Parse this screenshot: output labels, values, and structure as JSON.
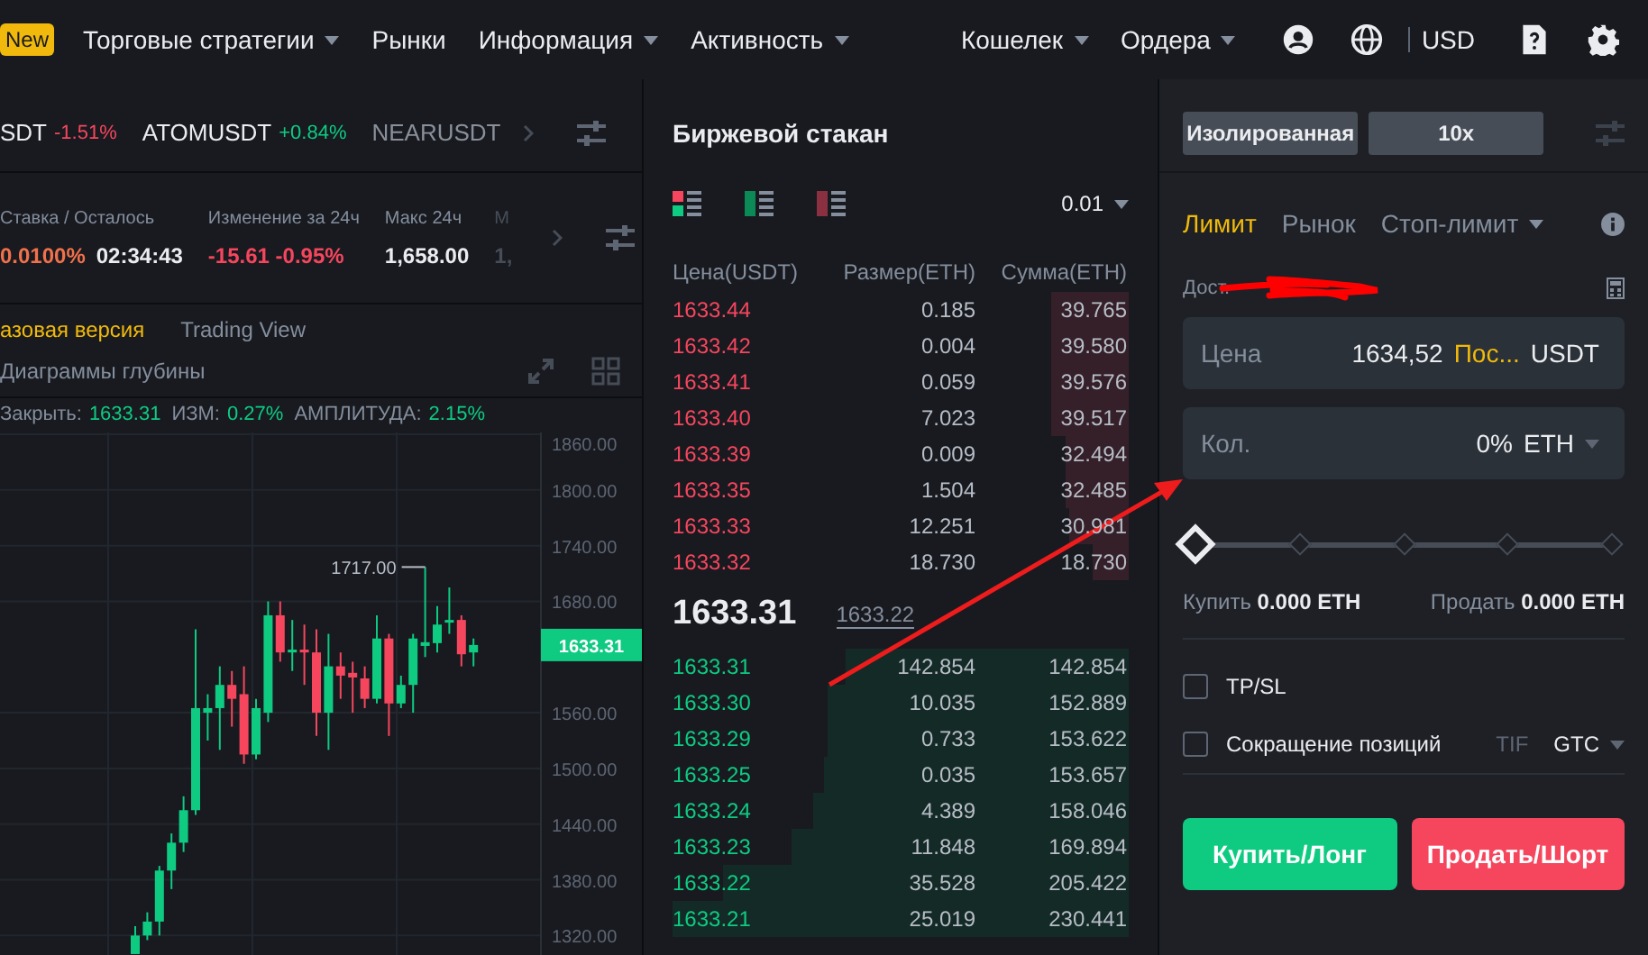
{
  "top_nav": {
    "badge": "New",
    "left_items": [
      {
        "label": "Торговые стратегии",
        "dropdown": true
      },
      {
        "label": "Рынки",
        "dropdown": false
      },
      {
        "label": "Информация",
        "dropdown": true
      },
      {
        "label": "Активность",
        "dropdown": true
      }
    ],
    "right_items": [
      {
        "label": "Кошелек",
        "dropdown": true
      },
      {
        "label": "Ордера",
        "dropdown": true
      }
    ],
    "currency": "USD"
  },
  "ticker": [
    {
      "symbol": "SDT",
      "change": "-1.51%",
      "color": "#f6465d",
      "faded": false
    },
    {
      "symbol": "ATOMUSDT",
      "change": "+0.84%",
      "color": "#0ecb81",
      "faded": false
    },
    {
      "symbol": "NEARUSDT",
      "faded": true
    }
  ],
  "stats": [
    {
      "label": "Ставка / Осталось",
      "faded": false,
      "values": [
        {
          "text": "0.0100%",
          "color": "#f0714b"
        },
        {
          "text": "02:34:43",
          "color": "#eaecef"
        }
      ]
    },
    {
      "label": "Изменение за 24ч",
      "faded": false,
      "values": [
        {
          "text": "-15.61 -0.95%",
          "color": "#f6465d"
        }
      ]
    },
    {
      "label": "Макс 24ч",
      "faded": false,
      "values": [
        {
          "text": "1,658.00",
          "color": "#eaecef"
        }
      ]
    },
    {
      "label": "М",
      "faded": true,
      "values": [
        {
          "text": "1,",
          "color": "#474d57"
        }
      ]
    }
  ],
  "chart_tabs": [
    {
      "label": "азовая версия",
      "selected": true
    },
    {
      "label": "Trading View",
      "selected": false
    }
  ],
  "depth_link": "Диаграммы глубины",
  "ohlc": [
    {
      "label": "Закрыть:",
      "value": "1633.31"
    },
    {
      "label": "ИЗМ:",
      "value": "0.27%"
    },
    {
      "label": "АМПЛИТУДА:",
      "value": "2.15%"
    }
  ],
  "chart": {
    "high_label": "1717.00",
    "last_price": "1633.31",
    "chart_data": {
      "type": "candlestick",
      "grid": true,
      "ylim": [
        1299,
        1862
      ],
      "ohlc": [
        [
          1300,
          1330,
          1300,
          1320
        ],
        [
          1320,
          1345,
          1315,
          1335
        ],
        [
          1335,
          1395,
          1320,
          1390
        ],
        [
          1390,
          1430,
          1370,
          1420
        ],
        [
          1420,
          1470,
          1410,
          1455
        ],
        [
          1455,
          1650,
          1450,
          1565
        ],
        [
          1560,
          1580,
          1530,
          1565
        ],
        [
          1565,
          1610,
          1520,
          1590
        ],
        [
          1590,
          1605,
          1545,
          1575
        ],
        [
          1580,
          1610,
          1505,
          1515
        ],
        [
          1515,
          1575,
          1510,
          1565
        ],
        [
          1560,
          1680,
          1550,
          1665
        ],
        [
          1665,
          1680,
          1615,
          1625
        ],
        [
          1625,
          1660,
          1605,
          1628
        ],
        [
          1628,
          1655,
          1590,
          1625
        ],
        [
          1625,
          1650,
          1535,
          1560
        ],
        [
          1560,
          1645,
          1520,
          1610
        ],
        [
          1610,
          1625,
          1575,
          1600
        ],
        [
          1603,
          1615,
          1560,
          1598
        ],
        [
          1597,
          1610,
          1565,
          1575
        ],
        [
          1575,
          1665,
          1570,
          1640
        ],
        [
          1640,
          1645,
          1535,
          1570
        ],
        [
          1570,
          1600,
          1565,
          1590
        ],
        [
          1590,
          1645,
          1560,
          1640
        ],
        [
          1632,
          1717,
          1620,
          1636
        ],
        [
          1635,
          1675,
          1625,
          1655
        ],
        [
          1658,
          1695,
          1645,
          1660
        ],
        [
          1660,
          1665,
          1610,
          1623
        ],
        [
          1625,
          1640,
          1610,
          1633
        ]
      ],
      "yticks": [
        {
          "value": 1860,
          "label": "1860.00"
        },
        {
          "value": 1800,
          "label": "1800.00"
        },
        {
          "value": 1740,
          "label": "1740.00"
        },
        {
          "value": 1680,
          "label": "1680.00"
        },
        {
          "value": 1560,
          "label": "1560.00"
        },
        {
          "value": 1500,
          "label": "1500.00"
        },
        {
          "value": 1440,
          "label": "1440.00"
        },
        {
          "value": 1380,
          "label": "1380.00"
        },
        {
          "value": 1320,
          "label": "1320.00"
        }
      ]
    }
  },
  "orderbook": {
    "title": "Биржевой стакан",
    "tick": "0.01",
    "columns": [
      "Цена(USDT)",
      "Размер(ETH)",
      "Сумма(ETH)"
    ],
    "asks": [
      {
        "price": "1633.44",
        "size": "0.185",
        "total": "39.765",
        "level": 0.17
      },
      {
        "price": "1633.42",
        "size": "0.004",
        "total": "39.580",
        "level": 0.17
      },
      {
        "price": "1633.41",
        "size": "0.059",
        "total": "39.576",
        "level": 0.17
      },
      {
        "price": "1633.40",
        "size": "7.023",
        "total": "39.517",
        "level": 0.17
      },
      {
        "price": "1633.39",
        "size": "0.009",
        "total": "32.494",
        "level": 0.14
      },
      {
        "price": "1633.35",
        "size": "1.504",
        "total": "32.485",
        "level": 0.14
      },
      {
        "price": "1633.33",
        "size": "12.251",
        "total": "30.981",
        "level": 0.13
      },
      {
        "price": "1633.32",
        "size": "18.730",
        "total": "18.730",
        "level": 0.08
      }
    ],
    "mid": {
      "price": "1633.31",
      "mark": "1633.22"
    },
    "bids": [
      {
        "price": "1633.31",
        "size": "142.854",
        "total": "142.854",
        "level": 0.62
      },
      {
        "price": "1633.30",
        "size": "10.035",
        "total": "152.889",
        "level": 0.66
      },
      {
        "price": "1633.29",
        "size": "0.733",
        "total": "153.622",
        "level": 0.66
      },
      {
        "price": "1633.25",
        "size": "0.035",
        "total": "153.657",
        "level": 0.67
      },
      {
        "price": "1633.24",
        "size": "4.389",
        "total": "158.046",
        "level": 0.69
      },
      {
        "price": "1633.23",
        "size": "11.848",
        "total": "169.894",
        "level": 0.74
      },
      {
        "price": "1633.22",
        "size": "35.528",
        "total": "205.422",
        "level": 0.89
      },
      {
        "price": "1633.21",
        "size": "25.019",
        "total": "230.441",
        "level": 1
      }
    ]
  },
  "order_form": {
    "margin_mode": "Изолированная",
    "leverage": "10x",
    "tabs": [
      {
        "label": "Лимит",
        "selected": true,
        "dropdown": false
      },
      {
        "label": "Рынок",
        "selected": false,
        "dropdown": false
      },
      {
        "label": "Стоп-лимит",
        "selected": false,
        "dropdown": true
      }
    ],
    "available_label": "Дост.",
    "price_field": {
      "label": "Цена",
      "value": "1634,52",
      "last_link": "Пос...",
      "unit": "USDT"
    },
    "qty_field": {
      "label": "Кол.",
      "value": "0%",
      "unit": "ETH"
    },
    "slider": {
      "level": 0
    },
    "buy_max": {
      "label": "Купить",
      "value": "0.000 ETH"
    },
    "sell_max": {
      "label": "Продать",
      "value": "0.000 ETH"
    },
    "options": [
      {
        "label": "TP/SL",
        "checked": false
      },
      {
        "label": "Сокращение позиций",
        "checked": false
      }
    ],
    "tif": {
      "label": "TIF",
      "value": "GTC"
    },
    "buttons": [
      {
        "label": "Купить/Лонг",
        "kind": "buy"
      },
      {
        "label": "Продать/Шорт",
        "kind": "sell"
      }
    ]
  }
}
